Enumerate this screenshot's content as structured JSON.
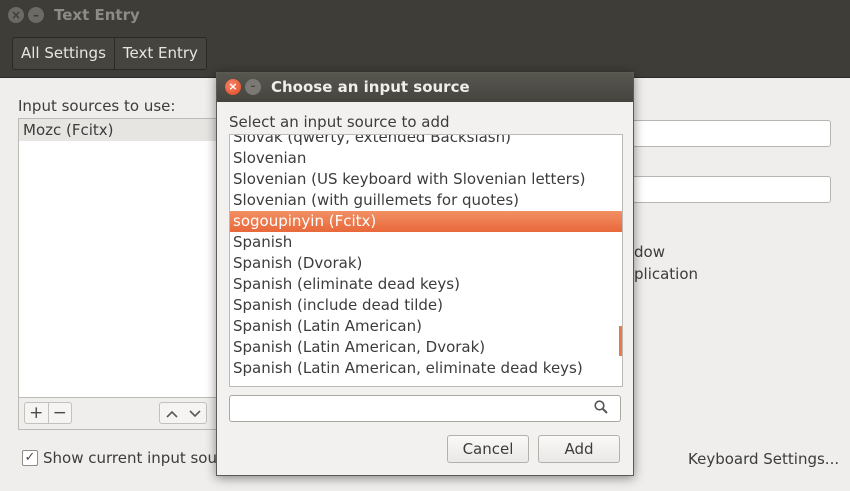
{
  "window": {
    "title": "Text Entry",
    "close_glyph": "×",
    "minimize_glyph": "–"
  },
  "breadcrumb": {
    "items": [
      {
        "label": "All Settings"
      },
      {
        "label": "Text Entry"
      }
    ]
  },
  "left_panel": {
    "label": "Input sources to use:",
    "sources": [
      {
        "label": "Mozc (Fcitx)"
      }
    ],
    "add_glyph": "+",
    "remove_glyph": "−",
    "up_glyph": "︿",
    "down_glyph": "﹀",
    "show_current_checkbox": {
      "label": "Show current input source",
      "checked": true,
      "glyph": "✓"
    }
  },
  "right_panel": {
    "partial_text_1": "dow",
    "partial_text_2": "plication",
    "keyboard_settings_link": "Keyboard Settings..."
  },
  "dialog": {
    "title": "Choose an input source",
    "close_glyph": "×",
    "minimize_glyph": "–",
    "subtitle": "Select an input source to add",
    "items": [
      {
        "label": "Slovak (qwerty, extended Backslash)"
      },
      {
        "label": "Slovenian"
      },
      {
        "label": "Slovenian (US keyboard with Slovenian letters)"
      },
      {
        "label": "Slovenian (with guillemets for quotes)"
      },
      {
        "label": "sogoupinyin (Fcitx)",
        "selected": true
      },
      {
        "label": "Spanish"
      },
      {
        "label": "Spanish (Dvorak)"
      },
      {
        "label": "Spanish (eliminate dead keys)"
      },
      {
        "label": "Spanish (include dead tilde)"
      },
      {
        "label": "Spanish (Latin American)"
      },
      {
        "label": "Spanish (Latin American, Dvorak)"
      },
      {
        "label": "Spanish (Latin American, eliminate dead keys)"
      }
    ],
    "search": {
      "value": "",
      "placeholder": ""
    },
    "cancel_label": "Cancel",
    "add_label": "Add"
  },
  "colors": {
    "selection": "#e8683a",
    "titlebar": "#3e3d38",
    "close_button": "#df4a1e"
  }
}
